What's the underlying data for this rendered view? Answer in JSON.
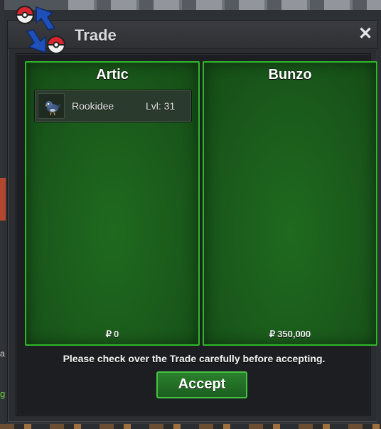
{
  "window": {
    "title": "Trade",
    "close_icon": "close-icon",
    "logo_icon": "trade-swap-pokeballs-icon"
  },
  "left_panel": {
    "player_name": "Artic",
    "items": [
      {
        "icon": "rookidee-icon",
        "name": "Rookidee",
        "level": "Lvl: 31"
      }
    ],
    "currency_symbol": "₽",
    "money": "0"
  },
  "right_panel": {
    "player_name": "Bunzo",
    "items": [],
    "currency_symbol": "₽",
    "money": "350,000"
  },
  "notice": "Please check over the Trade carefully before accepting.",
  "accept_label": "Accept",
  "colors": {
    "panel_green": "#1a5a1b",
    "panel_border": "#2fb82c",
    "button_green": "#2a7f2c"
  },
  "background": {
    "left_fragment_1": "a",
    "left_fragment_2": "g"
  }
}
